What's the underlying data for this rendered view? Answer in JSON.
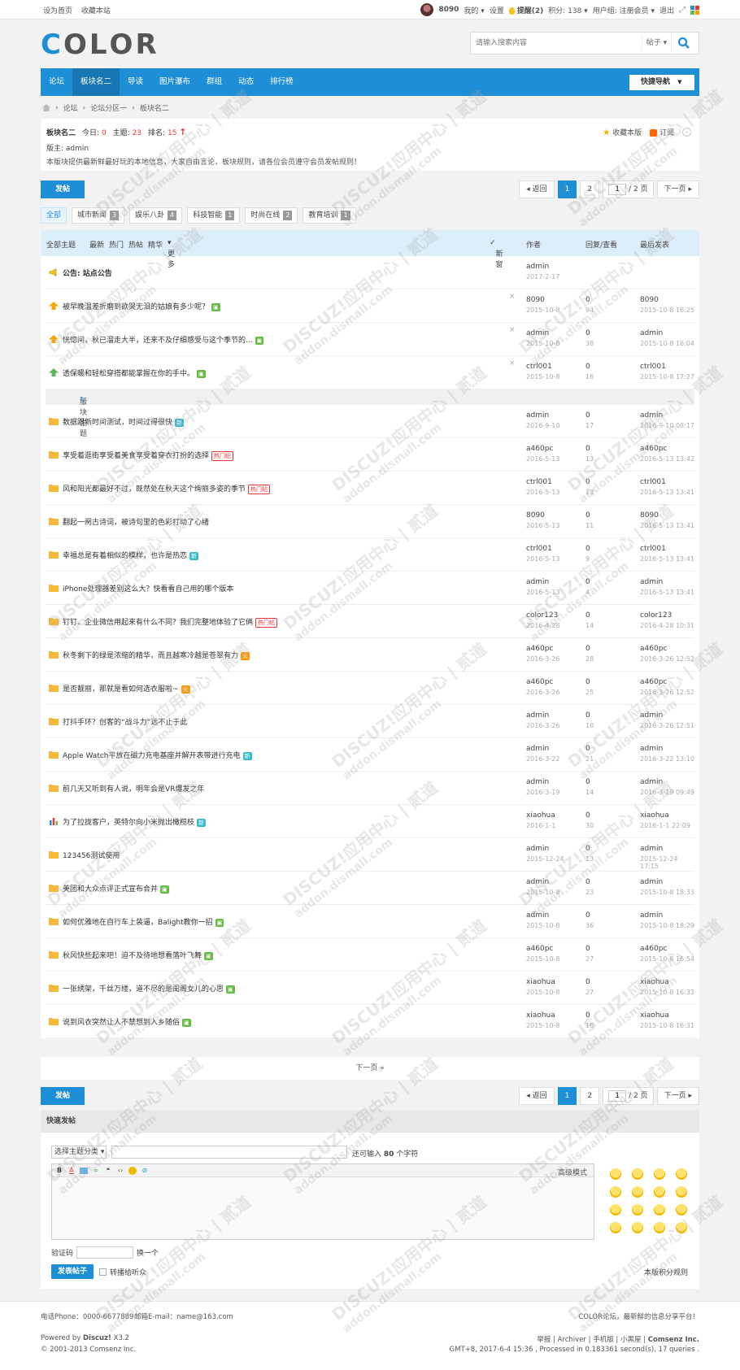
{
  "topbar": {
    "links": [
      "设为首页",
      "收藏本站"
    ],
    "user": "8090",
    "items": [
      "我的",
      "设置"
    ],
    "remind": "提醒(2)",
    "points": "积分: 138",
    "group": "用户组: 注册会员",
    "logout": "退出"
  },
  "logo": {
    "letters": [
      "C",
      "O",
      "L",
      "O",
      "R"
    ],
    "colors": [
      "#1e8fd6",
      "#555",
      "#555",
      "#555",
      "#555"
    ]
  },
  "search": {
    "placeholder": "请输入搜索内容",
    "type": "帖子"
  },
  "nav": {
    "items": [
      "论坛",
      "板块名二",
      "导读",
      "图片瀑布",
      "群组",
      "动态",
      "排行榜"
    ],
    "quick": "快捷导航"
  },
  "breadcrumb": [
    "论坛",
    "论坛分区一",
    "板块名二"
  ],
  "forum": {
    "name": "板块名二",
    "today_label": "今日:",
    "today": "0",
    "topics_label": "主题:",
    "topics": "23",
    "rank_label": "排名:",
    "rank": "15",
    "moderator": "版主: admin",
    "desc": "本版块提供最新鲜最好玩的本地信息，大家自由言论，板块规则，请各位会员遵守会员发帖规则！",
    "fav": "收藏本版",
    "sub": "订阅"
  },
  "post_button": "发帖",
  "pager": {
    "back": "返回",
    "pages": [
      "1",
      "2"
    ],
    "input": "1",
    "total": "/ 2 页",
    "next": "下一页"
  },
  "categories": [
    {
      "name": "全部",
      "count": ""
    },
    {
      "name": "城市新闻",
      "count": "3"
    },
    {
      "name": "娱乐八卦",
      "count": "4"
    },
    {
      "name": "科技智能",
      "count": "1"
    },
    {
      "name": "时尚在线",
      "count": "2"
    },
    {
      "name": "教育培训",
      "count": "1"
    }
  ],
  "thead": {
    "filters": [
      "全部主题",
      "最新",
      "热门",
      "热帖",
      "精华",
      "更多"
    ],
    "new": "新窗",
    "author": "作者",
    "reply": "回复/查看",
    "last": "最后发表"
  },
  "announce": {
    "title": "公告: 站点公告",
    "author": "admin",
    "date": "2017-2-17"
  },
  "sticky": [
    {
      "title": "被早晚温差折磨到欲哭无泪的姑娘有多少呢？",
      "author": "8090",
      "date": "2015-10-8",
      "replies": "0",
      "views": "94",
      "last": "8090",
      "last_date": "2015-10-8 16:25",
      "tag": "pic"
    },
    {
      "title": "恍惚间，秋已溜走大半，还来不及仔细感受与这个季节的...",
      "author": "admin",
      "date": "2015-10-8",
      "replies": "0",
      "views": "38",
      "last": "admin",
      "last_date": "2015-10-8 16:04",
      "tag": "pic"
    },
    {
      "title": "透保暖和轻松穿搭都能掌握在你的手中。",
      "author": "ctrl001",
      "date": "2015-10-8",
      "replies": "0",
      "views": "16",
      "last": "ctrl001",
      "last_date": "2015-10-8 17:27",
      "tag": "pic"
    }
  ],
  "section_label": "版块主题",
  "threads": [
    {
      "title": "数据跟新时间测试，时间过得很快",
      "author": "admin",
      "date": "2016-9-10",
      "replies": "0",
      "views": "17",
      "last": "admin",
      "last_date": "2016-9-10 08:17",
      "tag": "new",
      "tagtext": "新"
    },
    {
      "title": "享受着逛街享受着美食享受着穿衣打扮的选择",
      "author": "a460pc",
      "date": "2016-5-13",
      "replies": "0",
      "views": "13",
      "last": "a460pc",
      "last_date": "2016-5-13 13:42",
      "tag": "hot",
      "tagtext": "热门帖"
    },
    {
      "title": "风和阳光都最好不过，既然处在秋天这个绚丽多姿的季节",
      "author": "ctrl001",
      "date": "2016-5-13",
      "replies": "0",
      "views": "13",
      "last": "ctrl001",
      "last_date": "2016-5-13 13:41",
      "tag": "hot",
      "tagtext": "热门帖"
    },
    {
      "title": "翻起一阕古诗词，被诗句里的色彩打动了心绪",
      "author": "8090",
      "date": "2016-5-13",
      "replies": "0",
      "views": "11",
      "last": "8090",
      "last_date": "2016-5-13 13:41",
      "tag": "",
      "tagtext": ""
    },
    {
      "title": "幸福总是有着相似的模样，也许是热恋",
      "author": "ctrl001",
      "date": "2016-5-13",
      "replies": "0",
      "views": "9",
      "last": "ctrl001",
      "last_date": "2016-5-13 13:41",
      "tag": "new",
      "tagtext": "新"
    },
    {
      "title": "iPhone处理器差别这么大？快看看自己用的哪个版本",
      "author": "admin",
      "date": "2016-5-13",
      "replies": "0",
      "views": "4",
      "last": "admin",
      "last_date": "2016-5-13 13:41",
      "tag": "",
      "tagtext": ""
    },
    {
      "title": "钉钉、企业微信用起来有什么不同？我们完整地体验了它俩",
      "author": "color123",
      "date": "2016-4-28",
      "replies": "0",
      "views": "14",
      "last": "color123",
      "last_date": "2016-4-28 10:31",
      "tag": "hot",
      "tagtext": "热门帖"
    },
    {
      "title": "秋冬剩下的绿是浓缩的精华，而且越寒冷越是苍翠有力",
      "author": "a460pc",
      "date": "2016-3-26",
      "replies": "0",
      "views": "28",
      "last": "a460pc",
      "last_date": "2016-3-26 12:52",
      "tag": "fire",
      "tagtext": "火"
    },
    {
      "title": "是否靓丽，那就是看如何选衣服啦~",
      "author": "a460pc",
      "date": "2016-3-26",
      "replies": "0",
      "views": "25",
      "last": "a460pc",
      "last_date": "2016-3-26 12:52",
      "tag": "fire",
      "tagtext": "火"
    },
    {
      "title": "打抖手环？创客的“战斗力”远不止于此",
      "author": "admin",
      "date": "2016-3-26",
      "replies": "0",
      "views": "10",
      "last": "admin",
      "last_date": "2016-3-26 12:51",
      "tag": "",
      "tagtext": ""
    },
    {
      "title": "Apple Watch平放在磁力充电基座并解开表带进行充电",
      "author": "admin",
      "date": "2016-3-22",
      "replies": "0",
      "views": "21",
      "last": "admin",
      "last_date": "2016-3-22 13:10",
      "tag": "new",
      "tagtext": "新"
    },
    {
      "title": "前几天又听到有人说，明年会是VR爆发之年",
      "author": "admin",
      "date": "2016-3-19",
      "replies": "0",
      "views": "14",
      "last": "admin",
      "last_date": "2016-3-19 09:49",
      "tag": "",
      "tagtext": ""
    },
    {
      "title": "为了拉拢客户，英特尔向小米抛出橄榄枝",
      "author": "xiaohua",
      "date": "2016-1-1",
      "replies": "0",
      "views": "30",
      "last": "xiaohua",
      "last_date": "2016-1-1 22:09",
      "tag": "new",
      "tagtext": "新",
      "poll": true
    },
    {
      "title": "123456测试使用",
      "author": "admin",
      "date": "2015-12-24",
      "replies": "0",
      "views": "13",
      "last": "admin",
      "last_date": "2015-12-24 17:15",
      "tag": "",
      "tagtext": ""
    },
    {
      "title": "美团和大众点评正式宣布合并",
      "author": "admin",
      "date": "2015-10-8",
      "replies": "0",
      "views": "23",
      "last": "admin",
      "last_date": "2015-10-8 18:33",
      "tag": "pic",
      "tagtext": ""
    },
    {
      "title": "如何优雅地在自行车上装逼，Balight教你一招",
      "author": "admin",
      "date": "2015-10-8",
      "replies": "0",
      "views": "36",
      "last": "admin",
      "last_date": "2015-10-8 18:29",
      "tag": "pic",
      "tagtext": ""
    },
    {
      "title": "秋风快些起来吧！迫不及待地想看落叶飞舞",
      "author": "a460pc",
      "date": "2015-10-8",
      "replies": "0",
      "views": "27",
      "last": "a460pc",
      "last_date": "2015-10-8 16:54",
      "tag": "pic",
      "tagtext": ""
    },
    {
      "title": "一张绣架，千丝万缕，道不尽的是闺阁女儿的心思",
      "author": "xiaohua",
      "date": "2015-10-8",
      "replies": "0",
      "views": "27",
      "last": "xiaohua",
      "last_date": "2015-10-8 16:33",
      "tag": "pic",
      "tagtext": ""
    },
    {
      "title": "说到风衣突然让人不禁想到入乡随俗",
      "author": "xiaohua",
      "date": "2015-10-8",
      "replies": "0",
      "views": "16",
      "last": "xiaohua",
      "last_date": "2015-10-8 16:31",
      "tag": "pic",
      "tagtext": ""
    }
  ],
  "next_page": "下一页 »",
  "quickpost": {
    "title": "快速发帖",
    "select": "选择主题分类",
    "count_pre": "还可输入",
    "count": "80",
    "count_post": "个字符",
    "advanced": "高级模式",
    "captcha": "验证码",
    "refresh": "换一个",
    "submit": "发表帖子",
    "broadcast": "转播给听众",
    "rules": "本版积分规则"
  },
  "footer": {
    "phone": "电话Phone：0000-6677889",
    "email": "邮箱E-mail：name@163.com",
    "slogan": "COLOR论坛，最新鲜的信息分享平台！",
    "powered": "Powered by",
    "brand": "Discuz!",
    "version": "X3.2",
    "copy": "© 2001-2013 Comsenz Inc.",
    "links": [
      "举报",
      "Archiver",
      "手机版",
      "小黑屋"
    ],
    "company": "Comsenz Inc.",
    "gmt": "GMT+8, 2017-6-4 15:36 , Processed in 0.183361 second(s), 17 queries ."
  },
  "watermark": {
    "line1": "DISCUZ!应用中心 | 贰道",
    "line2": "addon.dismall.com"
  }
}
